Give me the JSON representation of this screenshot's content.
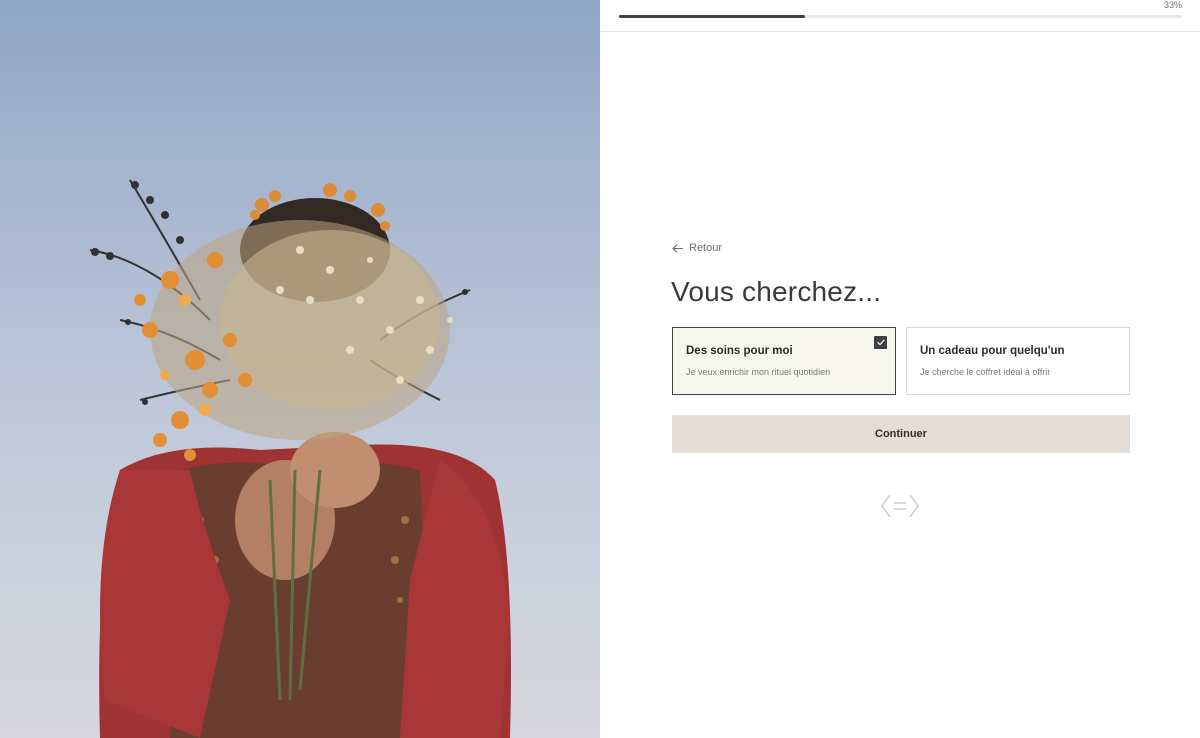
{
  "progress": {
    "value": 0.33,
    "label": "33%"
  },
  "nav": {
    "back_label": "Retour"
  },
  "question": {
    "title": "Vous cherchez..."
  },
  "options": [
    {
      "title": "Des soins pour moi",
      "subtitle": "Je veux enrichir mon rituel quotidien",
      "selected": true
    },
    {
      "title": "Un cadeau pour quelqu'un",
      "subtitle": "Je cherche le coffret idéal à offrir",
      "selected": false
    }
  ],
  "actions": {
    "continue_label": "Continuer"
  },
  "icons": {
    "back": "arrow-left-icon",
    "check": "checkmark-icon",
    "brand": "brand-logo-icon"
  },
  "colors": {
    "accent": "#3c3f44",
    "button_bg": "#e3dcd7",
    "selected_bg": "#f7f6ef"
  }
}
